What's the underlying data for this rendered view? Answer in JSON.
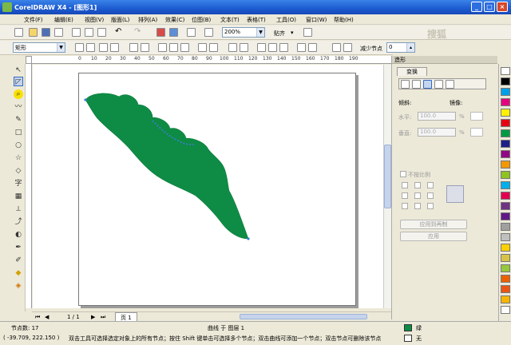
{
  "window": {
    "title": "CorelDRAW X4 - [图形1]",
    "controls": [
      "_",
      "□",
      "×"
    ]
  },
  "menu": [
    "文件(F)",
    "编辑(E)",
    "视图(V)",
    "版面(L)",
    "排列(A)",
    "效果(C)",
    "位图(B)",
    "文本(T)",
    "表格(T)",
    "工具(O)",
    "窗口(W)",
    "帮助(H)"
  ],
  "toolbar": {
    "zoom_value": "200%",
    "snap_label": "贴齐",
    "snap_arrow": "▾",
    "watermark_text": "搜狐"
  },
  "property_bar": {
    "object_combo": "矩形",
    "reduce_nodes_label": "减少节点",
    "reduce_nodes_value": "0"
  },
  "ruler": {
    "ticks": [
      "0",
      "10",
      "20",
      "30",
      "40",
      "50",
      "60",
      "70",
      "80",
      "90",
      "100",
      "110",
      "120",
      "130",
      "140",
      "150",
      "160",
      "170",
      "180",
      "190"
    ]
  },
  "document": {
    "page_count_text": "1 / 1",
    "page_tab": "页 1"
  },
  "docker": {
    "title": "造形",
    "tab": "变换",
    "tilt_label": "倾斜:",
    "mirror_label": "镜像:",
    "h_label": "水平:",
    "v_label": "垂直:",
    "h_value": "100.0",
    "v_value": "100.0",
    "unit": "%",
    "proportional_label": "不按比例",
    "apply_dup_button": "应用到再制",
    "apply_button": "应用"
  },
  "status": {
    "node_count": "节点数: 17",
    "curve_info": "曲线 于 图层 1",
    "coords": "( -39.709, 222.150 )",
    "hint": "双击工具可选择选定对象上的所有节点；按住 Shift 键单击可选择多个节点；双击曲线可添加一个节点；双击节点可删除该节点",
    "fill_label": "绿",
    "outline_label": "无"
  },
  "colors": {
    "leaf_fill": "#0e8c45",
    "title_bar": "#1c5bd0",
    "accent": "#316ac5"
  },
  "palette": [
    "#ffffff",
    "#000000",
    "#00a0e9",
    "#e4007f",
    "#fff100",
    "#e60012",
    "#009944",
    "#1d2088",
    "#920783",
    "#f39800",
    "#8fc31f",
    "#00afec",
    "#e5004f",
    "#6f3381",
    "#601986",
    "#a0a0a0",
    "#c0c0c0",
    "#fdd000",
    "#d7c447",
    "#97c83c",
    "#eb6100",
    "#ea5514",
    "#f8b500",
    "#ffffff"
  ]
}
